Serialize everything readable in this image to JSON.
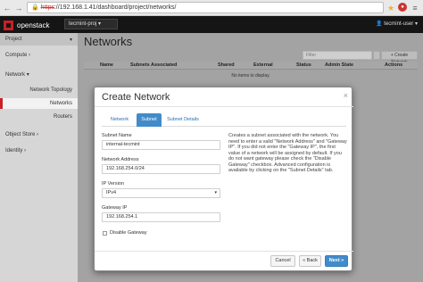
{
  "browser": {
    "url_scheme": "https",
    "url_rest": "://192.168.1.41/dashboard/project/networks/"
  },
  "topbar": {
    "brand": "openstack",
    "project": "tecmint-proj",
    "user": "tecmint-user"
  },
  "sidebar": {
    "project_label": "Project",
    "compute_label": "Compute",
    "network_label": "Network",
    "network_topology": "Network Topology",
    "networks": "Networks",
    "routers": "Routers",
    "object_store": "Object Store",
    "identity": "Identity"
  },
  "main": {
    "title": "Networks",
    "filter_placeholder": "Filter",
    "create_button": "+ Create Network",
    "columns": [
      "Name",
      "Subnets Associated",
      "Shared",
      "External",
      "Status",
      "Admin State",
      "Actions"
    ],
    "empty_text": "No items to display."
  },
  "modal": {
    "title": "Create Network",
    "close": "×",
    "tabs": [
      "Network",
      "Subnet",
      "Subnet Details"
    ],
    "active_tab": "Subnet",
    "subnet_name_label": "Subnet Name",
    "subnet_name_value": "internal-tecmint",
    "network_address_label": "Network Address",
    "network_address_value": "192.168.254.0/24",
    "ip_version_label": "IP Version",
    "ip_version_value": "IPv4",
    "gateway_ip_label": "Gateway IP",
    "gateway_ip_value": "192.168.254.1",
    "disable_gateway_label": "Disable Gateway",
    "disable_gateway_checked": false,
    "help_text": "Creates a subnet associated with the network. You need to enter a valid \"Network Address\" and \"Gateway IP\". If you did not enter the \"Gateway IP\", the first value of a network will be assigned by default. If you do not want gateway please check the \"Disable Gateway\" checkbox. Advanced configuration is available by clicking on the \"Subnet Details\" tab.",
    "cancel_button": "Cancel",
    "back_button": "« Back",
    "next_button": "Next »"
  },
  "colors": {
    "brand_red": "#c82027",
    "primary_blue": "#428bca"
  }
}
